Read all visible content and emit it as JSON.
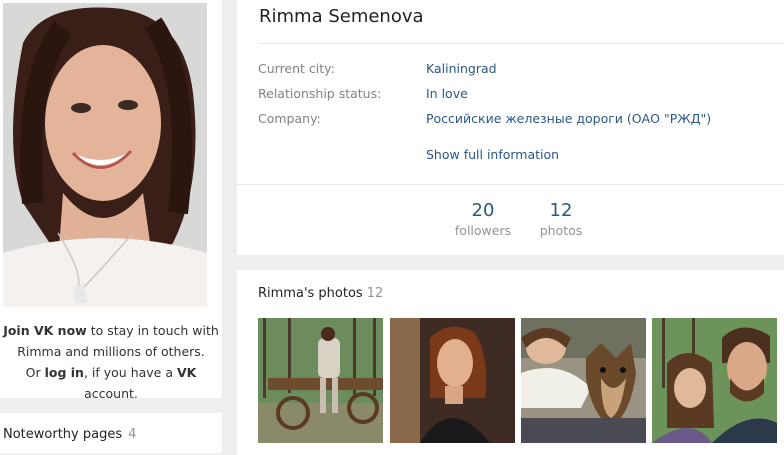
{
  "sidebar": {
    "join_vk": "Join VK now",
    "join_text_1": " to stay in touch with",
    "join_text_2": "Rimma and millions of others.",
    "or": "Or ",
    "log_in": "log in",
    "join_text_3": ", if you have a ",
    "vk": "VK",
    "account": " account.",
    "noteworthy_title": "Noteworthy pages",
    "noteworthy_count": "4"
  },
  "profile": {
    "name": "Rimma Semenova",
    "info": [
      {
        "label": "Current city:",
        "value": "Kaliningrad"
      },
      {
        "label": "Relationship status:",
        "value": "In love"
      },
      {
        "label": "Company:",
        "value": "Российские железные дороги (ОАО \"РЖД\")"
      }
    ],
    "show_full": "Show full information",
    "stats": [
      {
        "number": "20",
        "label": "followers"
      },
      {
        "number": "12",
        "label": "photos"
      }
    ]
  },
  "photos": {
    "title": "Rimma's photos",
    "count": "12"
  }
}
